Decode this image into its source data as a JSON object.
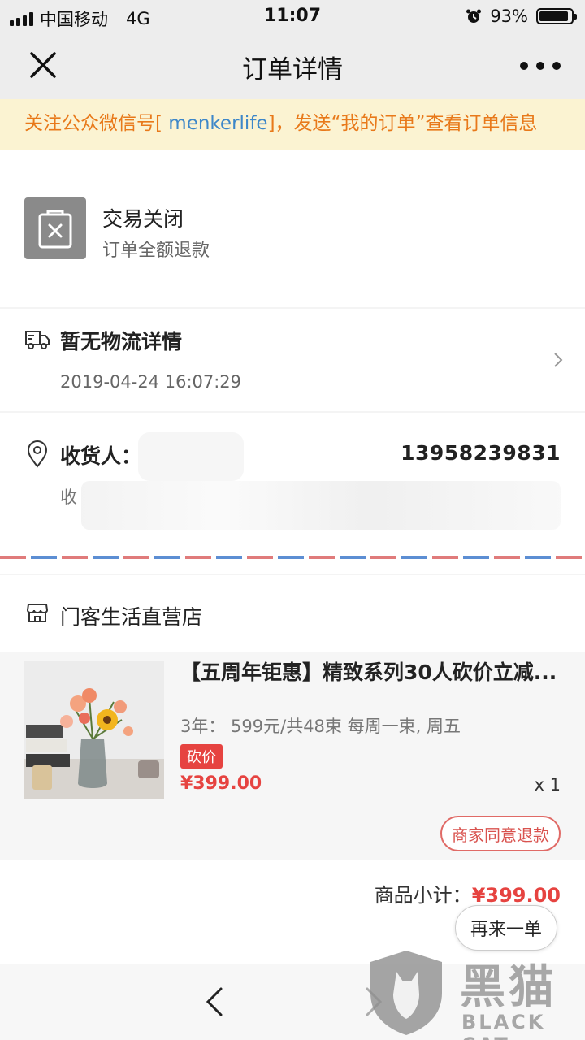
{
  "status_bar": {
    "carrier": "中国移动",
    "network": "4G",
    "time": "11:07",
    "battery": "93%",
    "battery_level": 0.93
  },
  "nav": {
    "title": "订单详情",
    "close_icon": "close-icon",
    "more_icon": "more-dots-icon"
  },
  "notice": {
    "prefix": "关注公众微信号[ ",
    "account": "menkerlife",
    "suffix": "]，发送“我的订单”查看订单信息"
  },
  "order_status": {
    "title": "交易关闭",
    "subtitle": "订单全额退款",
    "icon": "closed-bag-icon"
  },
  "logistics": {
    "title": "暂无物流详情",
    "time": "2019-04-24 16:07:29",
    "icon": "truck-icon"
  },
  "address": {
    "label": "收货人：",
    "phone": "13958239831",
    "address_prefix": "收",
    "icon": "location-pin-icon"
  },
  "shop": {
    "name": "门客生活直营店",
    "icon": "store-icon"
  },
  "product": {
    "title": "【五周年钜惠】精致系列30人砍价立减...",
    "spec": "3年：  599元/共48束 每周一束, 周五",
    "tag": "砍价",
    "price": "¥399.00",
    "quantity": "x 1",
    "refund_status": "商家同意退款"
  },
  "summary": {
    "subtotal_label": "商品小计：",
    "subtotal_value": "¥399.00"
  },
  "actions": {
    "reorder": "再来一单"
  },
  "watermark": {
    "text_cn": "黑猫",
    "text_en": "BLACK CAT"
  },
  "colors": {
    "accent_red": "#e64340",
    "notice_orange": "#e8791a",
    "link_blue": "#3d87c9"
  }
}
